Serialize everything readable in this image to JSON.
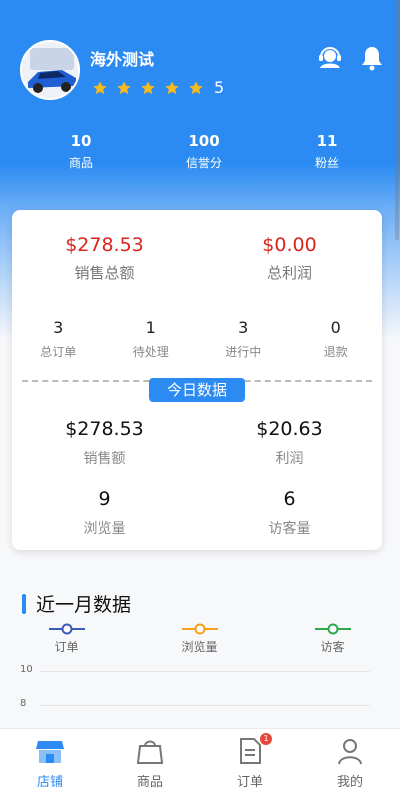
{
  "header": {
    "shop_name": "海外测试",
    "rating": "5",
    "stats": [
      {
        "value": "10",
        "label": "商品"
      },
      {
        "value": "100",
        "label": "信誉分"
      },
      {
        "value": "11",
        "label": "粉丝"
      }
    ],
    "icons": {
      "service": "headset-icon",
      "notify": "bell-icon"
    }
  },
  "summary": {
    "sales_total": {
      "value": "$278.53",
      "label": "销售总额"
    },
    "profit_total": {
      "value": "$0.00",
      "label": "总利润"
    },
    "orders": [
      {
        "value": "3",
        "label": "总订单"
      },
      {
        "value": "1",
        "label": "待处理"
      },
      {
        "value": "3",
        "label": "进行中"
      },
      {
        "value": "0",
        "label": "退款"
      }
    ],
    "today_label": "今日数据",
    "today": [
      {
        "value": "$278.53",
        "label": "销售额"
      },
      {
        "value": "$20.63",
        "label": "利润"
      },
      {
        "value": "9",
        "label": "浏览量"
      },
      {
        "value": "6",
        "label": "访客量"
      }
    ]
  },
  "month": {
    "title": "近一月数据",
    "legend": [
      {
        "label": "订单",
        "color": "#3a5bb8"
      },
      {
        "label": "浏览量",
        "color": "#f2a21c"
      },
      {
        "label": "访客",
        "color": "#2ea84a"
      }
    ],
    "y_ticks": [
      "10",
      "8"
    ]
  },
  "tabbar": {
    "items": [
      {
        "label": "店铺",
        "icon": "shop-icon",
        "active": true
      },
      {
        "label": "商品",
        "icon": "bag-icon"
      },
      {
        "label": "订单",
        "icon": "document-icon",
        "badge": "1"
      },
      {
        "label": "我的",
        "icon": "user-icon"
      }
    ]
  },
  "colors": {
    "primary": "#2b8bf2",
    "money": "#d9261c"
  }
}
